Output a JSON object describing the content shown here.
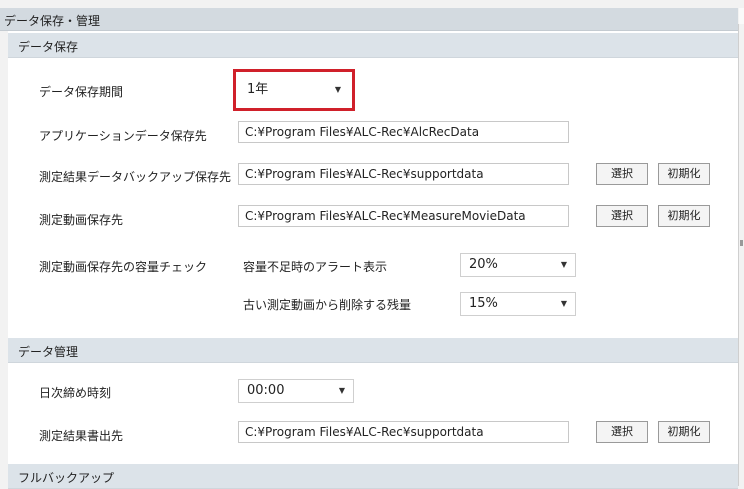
{
  "header": {
    "title": "データ保存・管理"
  },
  "sections": {
    "data_save": "データ保存",
    "data_manage": "データ管理",
    "full_backup": "フルバックアップ"
  },
  "data_save": {
    "period": {
      "label": "データ保存期間",
      "value": "1年"
    },
    "app_data": {
      "label": "アプリケーションデータ保存先",
      "value": "C:¥Program Files¥ALC-Rec¥AlcRecData"
    },
    "backup": {
      "label": "測定結果データバックアップ保存先",
      "value": "C:¥Program Files¥ALC-Rec¥supportdata"
    },
    "movie": {
      "label": "測定動画保存先",
      "value": "C:¥Program Files¥ALC-Rec¥MeasureMovieData"
    },
    "capacity": {
      "label": "測定動画保存先の容量チェック",
      "alert_label": "容量不足時のアラート表示",
      "alert_value": "20%",
      "delete_label": "古い測定動画から削除する残量",
      "delete_value": "15%"
    }
  },
  "data_manage": {
    "daily_close": {
      "label": "日次締め時刻",
      "value": "00:00"
    },
    "export": {
      "label": "測定結果書出先",
      "value": "C:¥Program Files¥ALC-Rec¥supportdata"
    }
  },
  "buttons": {
    "select": "選択",
    "reset": "初期化"
  },
  "icons": {
    "dropdown": "dropdown-arrow-icon"
  },
  "colors": {
    "highlight": "#d0202a",
    "header_bg": "#d3dae0",
    "section_bg": "#dce3e9"
  }
}
